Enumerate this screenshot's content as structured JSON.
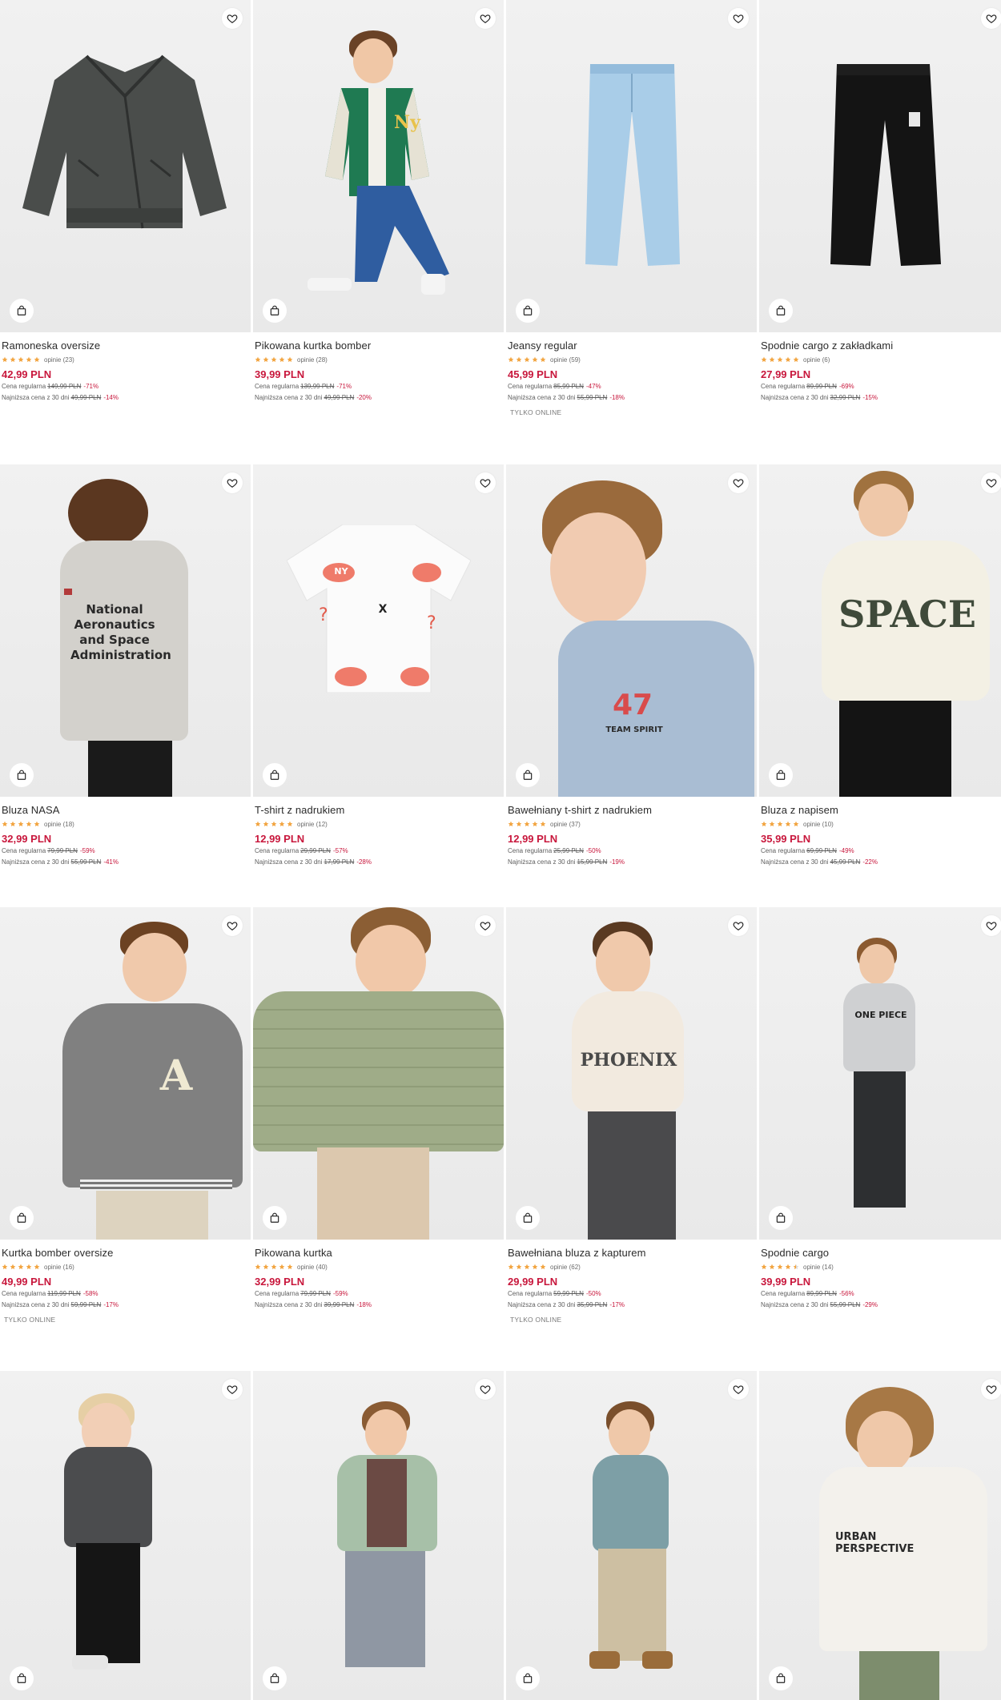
{
  "colors": {
    "price": "#c8173c",
    "discount": "#c8173c",
    "star": "#f2a541",
    "text": "#2b2b2b",
    "photo_bg": "#eeeeee"
  },
  "labels": {
    "regular_price": "Cena regularna",
    "lowest_price": "Najniższa cena z 30 dni"
  },
  "products": [
    {
      "name": "Ramoneska oversize",
      "reviews": "opinie (23)",
      "rating": 5,
      "price": "42,99 PLN",
      "regular_old": "149,99 PLN",
      "regular_disc": "-71%",
      "lowest_old": "49,99 PLN",
      "lowest_disc": "-14%",
      "badge": ""
    },
    {
      "name": "Pikowana kurtka bomber",
      "reviews": "opinie (28)",
      "rating": 5,
      "price": "39,99 PLN",
      "regular_old": "139,99 PLN",
      "regular_disc": "-71%",
      "lowest_old": "49,99 PLN",
      "lowest_disc": "-20%",
      "badge": ""
    },
    {
      "name": "Jeansy regular",
      "reviews": "opinie (59)",
      "rating": 5,
      "price": "45,99 PLN",
      "regular_old": "85,99 PLN",
      "regular_disc": "-47%",
      "lowest_old": "55,99 PLN",
      "lowest_disc": "-18%",
      "badge": "TYLKO ONLINE"
    },
    {
      "name": "Spodnie cargo z zakładkami",
      "reviews": "opinie (6)",
      "rating": 5,
      "price": "27,99 PLN",
      "regular_old": "89,99 PLN",
      "regular_disc": "-69%",
      "lowest_old": "32,99 PLN",
      "lowest_disc": "-15%",
      "badge": ""
    },
    {
      "name": "Bluza NASA",
      "reviews": "opinie (18)",
      "rating": 5,
      "price": "32,99 PLN",
      "regular_old": "79,99 PLN",
      "regular_disc": "-59%",
      "lowest_old": "55,99 PLN",
      "lowest_disc": "-41%",
      "badge": ""
    },
    {
      "name": "T-shirt z nadrukiem",
      "reviews": "opinie (12)",
      "rating": 5,
      "price": "12,99 PLN",
      "regular_old": "29,99 PLN",
      "regular_disc": "-57%",
      "lowest_old": "17,99 PLN",
      "lowest_disc": "-28%",
      "badge": ""
    },
    {
      "name": "Bawełniany t-shirt z nadrukiem",
      "reviews": "opinie (37)",
      "rating": 5,
      "price": "12,99 PLN",
      "regular_old": "25,99 PLN",
      "regular_disc": "-50%",
      "lowest_old": "15,99 PLN",
      "lowest_disc": "-19%",
      "badge": ""
    },
    {
      "name": "Bluza z napisem",
      "reviews": "opinie (10)",
      "rating": 5,
      "price": "35,99 PLN",
      "regular_old": "69,99 PLN",
      "regular_disc": "-49%",
      "lowest_old": "45,99 PLN",
      "lowest_disc": "-22%",
      "badge": ""
    },
    {
      "name": "Kurtka bomber oversize",
      "reviews": "opinie (16)",
      "rating": 5,
      "price": "49,99 PLN",
      "regular_old": "119,99 PLN",
      "regular_disc": "-58%",
      "lowest_old": "59,99 PLN",
      "lowest_disc": "-17%",
      "badge": "TYLKO ONLINE"
    },
    {
      "name": "Pikowana kurtka",
      "reviews": "opinie (40)",
      "rating": 5,
      "price": "32,99 PLN",
      "regular_old": "79,99 PLN",
      "regular_disc": "-59%",
      "lowest_old": "39,99 PLN",
      "lowest_disc": "-18%",
      "badge": ""
    },
    {
      "name": "Bawełniana bluza z kapturem",
      "reviews": "opinie (62)",
      "rating": 5,
      "price": "29,99 PLN",
      "regular_old": "59,99 PLN",
      "regular_disc": "-50%",
      "lowest_old": "35,99 PLN",
      "lowest_disc": "-17%",
      "badge": "TYLKO ONLINE"
    },
    {
      "name": "Spodnie cargo",
      "reviews": "opinie (14)",
      "rating": 4.5,
      "price": "39,99 PLN",
      "regular_old": "89,99 PLN",
      "regular_disc": "-56%",
      "lowest_old": "55,99 PLN",
      "lowest_disc": "-29%",
      "badge": ""
    }
  ],
  "graphics": {
    "nasa_print": "National Aeronautics and Space Administration",
    "space_print": "SPACE",
    "team_print": "TEAM SPIRIT",
    "team_number": "47",
    "phoenix_print": "PHOENIX",
    "onepiece_print": "ONE PIECE",
    "urban_print": "URBAN PERSPECTIVE",
    "bomber_letter": "A",
    "ny_print": "NY"
  },
  "icons": {
    "favorite": "heart-icon",
    "add_to_cart": "shopping-bag-icon",
    "rating": "star-icon"
  }
}
